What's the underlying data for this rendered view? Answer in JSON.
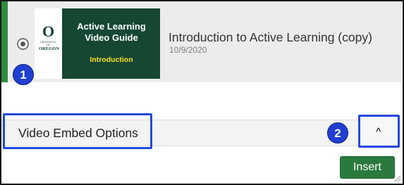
{
  "video": {
    "thumbnail_title": "Active Learning Video Guide",
    "thumbnail_subtitle": "Introduction",
    "logo_small_text": "UNIVERSITY OF",
    "logo_big_text": "OREGON",
    "logo_mark": "O",
    "title": "Introduction to Active Learning (copy)",
    "date": "10/9/2020",
    "selected": true
  },
  "embed_options": {
    "label": "Video Embed Options",
    "toggle_icon": "chevron-up-icon",
    "toggle_glyph": "^"
  },
  "actions": {
    "insert_label": "Insert"
  },
  "callouts": {
    "first": "1",
    "second": "2"
  },
  "colors": {
    "accent_green": "#2f8a3e",
    "thumbnail_bg": "#154733",
    "thumbnail_yellow": "#fee11a",
    "callout_blue": "#1f3fd1",
    "highlight_blue": "#2349e0",
    "insert_button": "#2b7a3d"
  }
}
